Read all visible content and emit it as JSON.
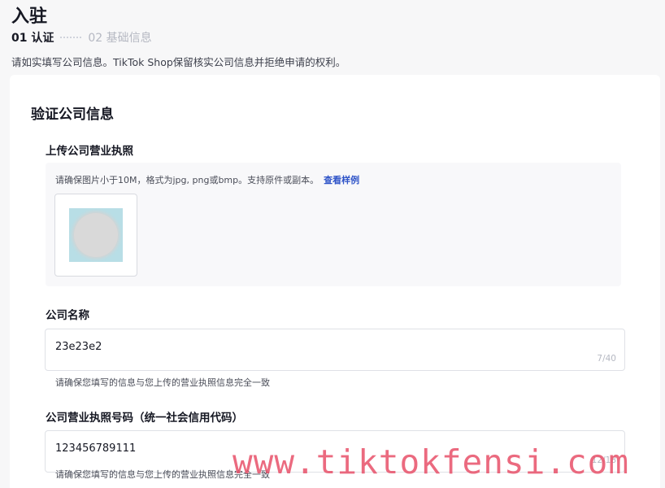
{
  "header": {
    "title": "入驻",
    "steps": [
      {
        "label": "01 认证"
      },
      {
        "label": "02 基础信息"
      }
    ],
    "notice": "请如实填写公司信息。TikTok Shop保留核实公司信息并拒绝申请的权利。"
  },
  "form": {
    "section_title": "验证公司信息",
    "license_upload": {
      "label": "上传公司营业执照",
      "hint": "请确保图片小于10M，格式为jpg, png或bmp。支持原件或副本。",
      "sample_link": "查看样例"
    },
    "company_name": {
      "label": "公司名称",
      "value": "23e23e2",
      "counter": "7/40",
      "help": "请确保您填写的信息与您上传的营业执照信息完全一致"
    },
    "license_number": {
      "label": "公司营业执照号码（统一社会信用代码）",
      "value": "123456789111",
      "counter": "12/18",
      "help": "请确保您填写的信息与您上传的营业执照信息完全一致"
    }
  },
  "watermark": "www.tiktokfensi.com",
  "colors": {
    "link": "#2f54c8",
    "watermark": "#e85068",
    "background": "#f7f7f8"
  }
}
